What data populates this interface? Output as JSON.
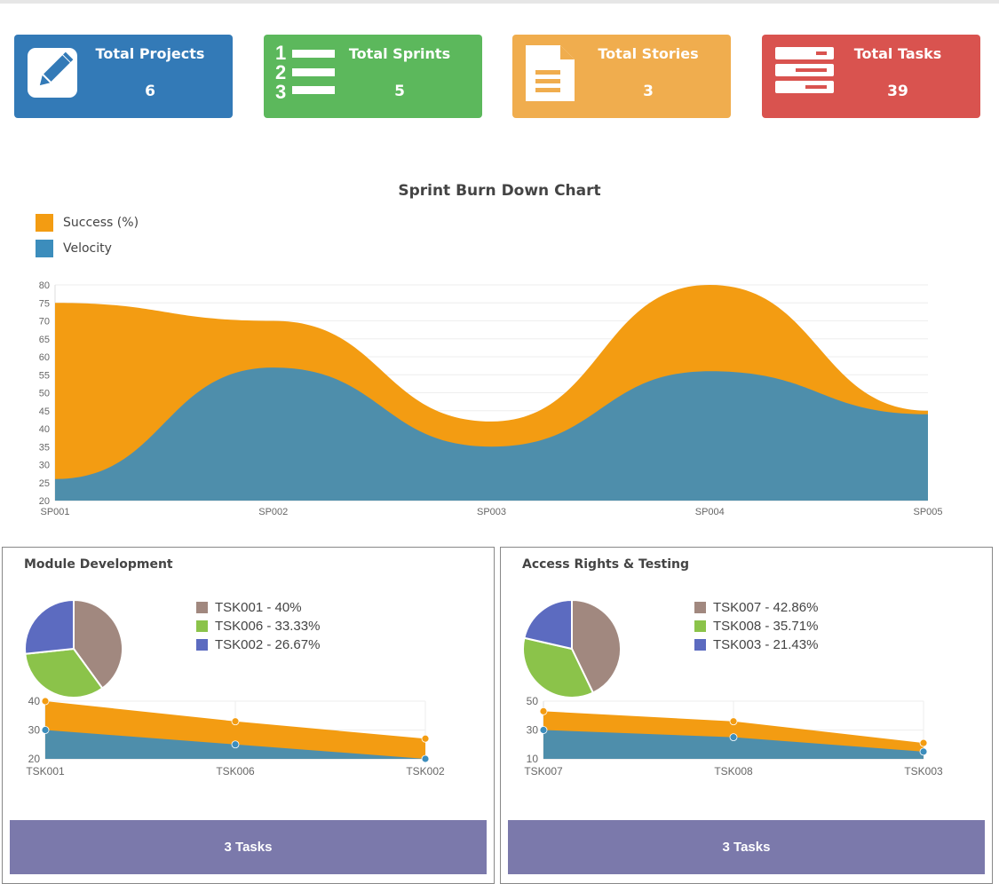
{
  "stats": [
    {
      "title": "Total Projects",
      "value": "6",
      "color": "#337ab7",
      "icon": "pencil-icon"
    },
    {
      "title": "Total Sprints",
      "value": "5",
      "color": "#5cb85c",
      "icon": "numbered-list-icon"
    },
    {
      "title": "Total Stories",
      "value": "3",
      "color": "#f0ad4e",
      "icon": "document-icon"
    },
    {
      "title": "Total Tasks",
      "value": "39",
      "color": "#d9534f",
      "icon": "server-list-icon"
    }
  ],
  "chart_data": [
    {
      "type": "area",
      "title": "Sprint Burn Down Chart",
      "categories": [
        "SP001",
        "SP002",
        "SP003",
        "SP004",
        "SP005"
      ],
      "series": [
        {
          "name": "Success (%)",
          "color": "#f39c12",
          "values": [
            75,
            70,
            42,
            80,
            45
          ]
        },
        {
          "name": "Velocity",
          "color": "#3c8dbc",
          "values": [
            26,
            57,
            35,
            56,
            44
          ]
        }
      ],
      "ylim": [
        20,
        80
      ],
      "yticks": [
        20,
        25,
        30,
        35,
        40,
        45,
        50,
        55,
        60,
        65,
        70,
        75,
        80
      ],
      "legend": "top-left"
    },
    {
      "type": "pie",
      "title": "Module Development",
      "labels": [
        "TSK001 - 40%",
        "TSK006 - 33.33%",
        "TSK002 - 26.67%"
      ],
      "values": [
        40,
        33.33,
        26.67
      ],
      "colors": [
        "#a1887f",
        "#8bc34a",
        "#5c6bc0"
      ]
    },
    {
      "type": "area",
      "categories": [
        "TSK001",
        "TSK006",
        "TSK002"
      ],
      "series": [
        {
          "color": "#f39c12",
          "values": [
            40,
            33,
            27
          ]
        },
        {
          "color": "#3c8dbc",
          "values": [
            30,
            25,
            20
          ]
        }
      ],
      "ylim": [
        20,
        40
      ],
      "yticks": [
        20,
        30,
        40
      ]
    },
    {
      "type": "pie",
      "title": "Access Rights & Testing",
      "labels": [
        "TSK007 - 42.86%",
        "TSK008 - 35.71%",
        "TSK003 - 21.43%"
      ],
      "values": [
        42.86,
        35.71,
        21.43
      ],
      "colors": [
        "#a1887f",
        "#8bc34a",
        "#5c6bc0"
      ]
    },
    {
      "type": "area",
      "categories": [
        "TSK007",
        "TSK008",
        "TSK003"
      ],
      "series": [
        {
          "color": "#f39c12",
          "values": [
            43,
            36,
            21
          ]
        },
        {
          "color": "#3c8dbc",
          "values": [
            30,
            25,
            15
          ]
        }
      ],
      "ylim": [
        10,
        50
      ],
      "yticks": [
        10,
        30,
        50
      ]
    }
  ],
  "panels": [
    {
      "footer": "3 Tasks"
    },
    {
      "footer": "3 Tasks"
    }
  ]
}
